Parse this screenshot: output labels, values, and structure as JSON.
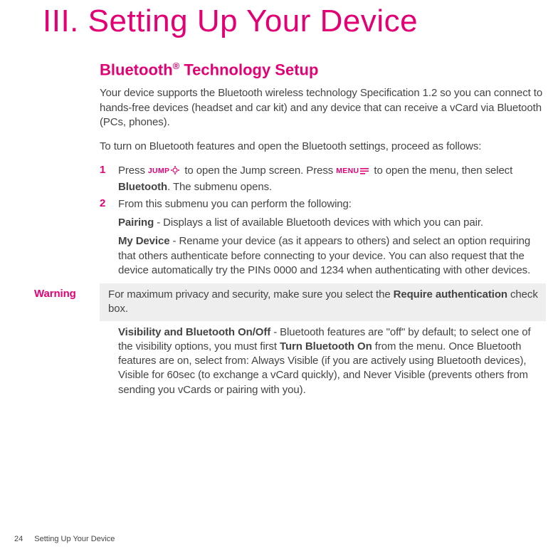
{
  "chapter": {
    "title": "III. Setting Up Your Device"
  },
  "section": {
    "heading_pre": "Bluetooth",
    "heading_sup": "®",
    "heading_post": " Technology Setup",
    "intro": "Your device supports the Bluetooth wireless technology Specification 1.2 so you can connect to hands-free devices (headset and car kit) and any device that can receive a vCard via Bluetooth (PCs, phones).",
    "proceed": "To turn on Bluetooth features and open the Bluetooth settings, proceed as follows:"
  },
  "keys": {
    "jump": "JUMP",
    "menu": "MENU"
  },
  "steps": {
    "s1": {
      "num": "1",
      "a": "Press ",
      "b": " to open the Jump screen. Press ",
      "c": " to open the menu, then select ",
      "bluetooth": "Bluetooth",
      "d": ". The submenu opens."
    },
    "s2": {
      "num": "2",
      "text": "From this submenu you can perform the following:"
    }
  },
  "sub": {
    "pairing_label": "Pairing",
    "pairing_text": " - Displays a list of available Bluetooth devices with which you can pair.",
    "mydevice_label": "My Device",
    "mydevice_text": " - Rename your device (as it appears to others) and select an option requiring that others authenticate before connecting to your device. You can also request that the device automatically try the PINs 0000 and 1234 when authenticating with other devices.",
    "visibility_label": "Visibility and Bluetooth On/Off",
    "visibility_a": " - Bluetooth features are \"off\" by default; to select one of the visibility options, you must first ",
    "visibility_turn_on": "Turn Bluetooth On",
    "visibility_b": " from the menu. Once Bluetooth features are on, select from: Always Visible (if you are actively using Bluetooth devices), Visible for 60sec (to exchange a vCard quickly), and Never Visible (prevents others from sending you vCards or pairing with you)."
  },
  "warning": {
    "label": "Warning",
    "a": "For maximum privacy and security, make sure you select the ",
    "req": "Require authentication",
    "b": " check box."
  },
  "footer": {
    "page": "24",
    "section": "Setting Up Your Device"
  }
}
